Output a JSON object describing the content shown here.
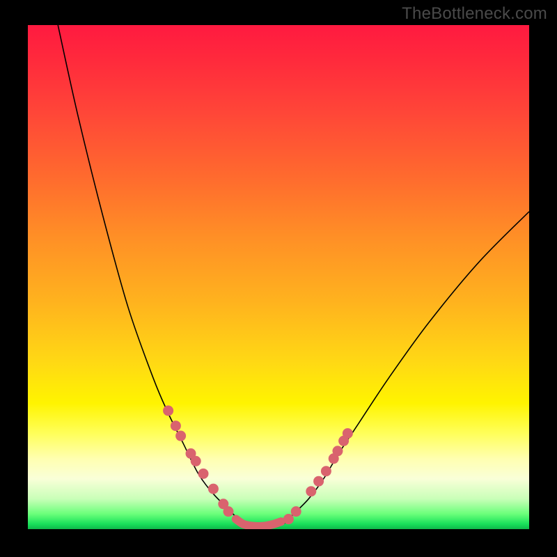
{
  "watermark": "TheBottleneck.com",
  "colors": {
    "black": "#000000",
    "dot": "#d9636e",
    "gradient_top": "#ff1a40",
    "gradient_mid": "#fff400",
    "gradient_bottom": "#0fb84a"
  },
  "chart_data": {
    "type": "line",
    "title": "",
    "xlabel": "",
    "ylabel": "",
    "xlim": [
      0,
      100
    ],
    "ylim": [
      0,
      100
    ],
    "series": [
      {
        "name": "left-curve",
        "x": [
          6,
          10,
          15,
          20,
          25,
          28,
          31,
          34,
          37,
          40,
          42,
          44
        ],
        "y": [
          100,
          82,
          62,
          44,
          30,
          23,
          17,
          11,
          7,
          4,
          2,
          1
        ]
      },
      {
        "name": "right-curve",
        "x": [
          51,
          53,
          56,
          59,
          62,
          66,
          72,
          80,
          90,
          100
        ],
        "y": [
          1,
          3,
          6,
          10,
          15,
          21,
          30,
          41,
          53,
          63
        ]
      },
      {
        "name": "dots-left",
        "x": [
          28.0,
          29.5,
          30.5,
          32.5,
          33.5,
          35.0,
          37.0,
          39.0,
          40.0
        ],
        "y": [
          23.5,
          20.5,
          18.5,
          15.0,
          13.5,
          11.0,
          8.0,
          5.0,
          3.5
        ]
      },
      {
        "name": "dots-right",
        "x": [
          52.0,
          53.5,
          56.5,
          58.0,
          59.5,
          61.0,
          61.8,
          63.0,
          63.8
        ],
        "y": [
          2.0,
          3.5,
          7.5,
          9.5,
          11.5,
          14.0,
          15.5,
          17.5,
          19.0
        ]
      },
      {
        "name": "trough",
        "x": [
          41.5,
          43,
          45,
          47,
          49,
          50.5
        ],
        "y": [
          2,
          1,
          0.6,
          0.6,
          1,
          1.5
        ]
      }
    ]
  }
}
